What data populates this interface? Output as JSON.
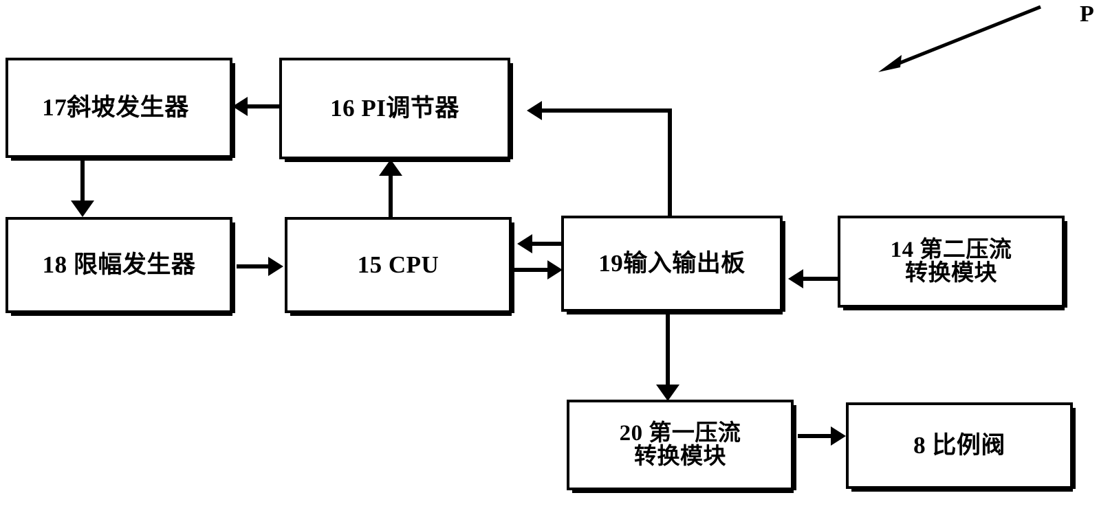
{
  "figure": {
    "type": "block-diagram",
    "reference_label": "P",
    "background_color": "#ffffff",
    "stroke_color": "#000000"
  },
  "blocks": [
    {
      "id": "17",
      "text": "17斜坡发生器",
      "number": "17",
      "name": "斜坡发生器"
    },
    {
      "id": "16",
      "text": "16 PI调节器",
      "number": "16",
      "name": "PI调节器"
    },
    {
      "id": "18",
      "text": "18 限幅发生器",
      "number": "18",
      "name": "限幅发生器"
    },
    {
      "id": "15",
      "text": "15 CPU",
      "number": "15",
      "name": "CPU"
    },
    {
      "id": "19",
      "text": "19输入输出板",
      "number": "19",
      "name": "输入输出板"
    },
    {
      "id": "14",
      "text": "14 第二压流\n转换模块",
      "number": "14",
      "name": "第二压流转换模块"
    },
    {
      "id": "20",
      "text": "20 第一压流\n转换模块",
      "number": "20",
      "name": "第一压流转换模块"
    },
    {
      "id": "8",
      "text": "8  比例阀",
      "number": "8",
      "name": "比例阀"
    }
  ],
  "connections": [
    {
      "from": "16",
      "to": "17",
      "direction": "left"
    },
    {
      "from": "17",
      "to": "18",
      "direction": "down"
    },
    {
      "from": "18",
      "to": "15",
      "direction": "right"
    },
    {
      "from": "15",
      "to": "16",
      "direction": "up"
    },
    {
      "from": "19",
      "to": "15",
      "direction": "left"
    },
    {
      "from": "15",
      "to": "19",
      "direction": "right"
    },
    {
      "from": "19",
      "to": "16",
      "direction": "left"
    },
    {
      "from": "14",
      "to": "19",
      "direction": "left"
    },
    {
      "from": "19",
      "to": "20",
      "direction": "down"
    },
    {
      "from": "20",
      "to": "8",
      "direction": "right"
    }
  ]
}
